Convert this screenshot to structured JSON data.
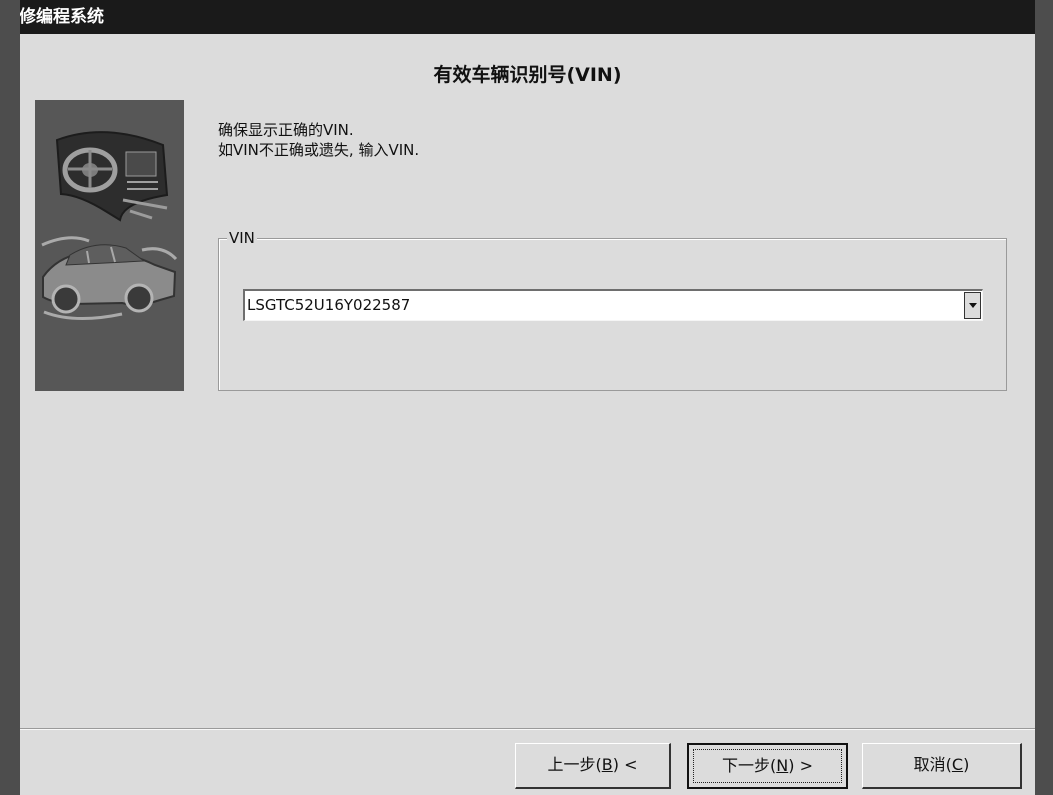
{
  "window": {
    "title": "维修编程系统"
  },
  "dialog": {
    "heading": "有效车辆识别号(VIN)",
    "instruction_line1": "确保显示正确的VIN.",
    "instruction_line2": "如VIN不正确或遗失, 输入VIN."
  },
  "vin_group": {
    "legend": "VIN",
    "value": "LSGTC52U16Y022587"
  },
  "buttons": {
    "back_prefix": "上一步(",
    "back_key": "B",
    "back_suffix": ") <",
    "next_prefix": "下一步(",
    "next_key": "N",
    "next_suffix": ") >",
    "cancel_prefix": "取消(",
    "cancel_key": "C",
    "cancel_suffix": ")"
  },
  "colors": {
    "titlebar": "#1a1a1a",
    "dialog_bg": "#dcdcdc",
    "side_panel": "#575757"
  },
  "icons": {
    "side_panel_top": "dashboard-steering-wheel-icon",
    "side_panel_bottom": "sedan-car-icon"
  }
}
